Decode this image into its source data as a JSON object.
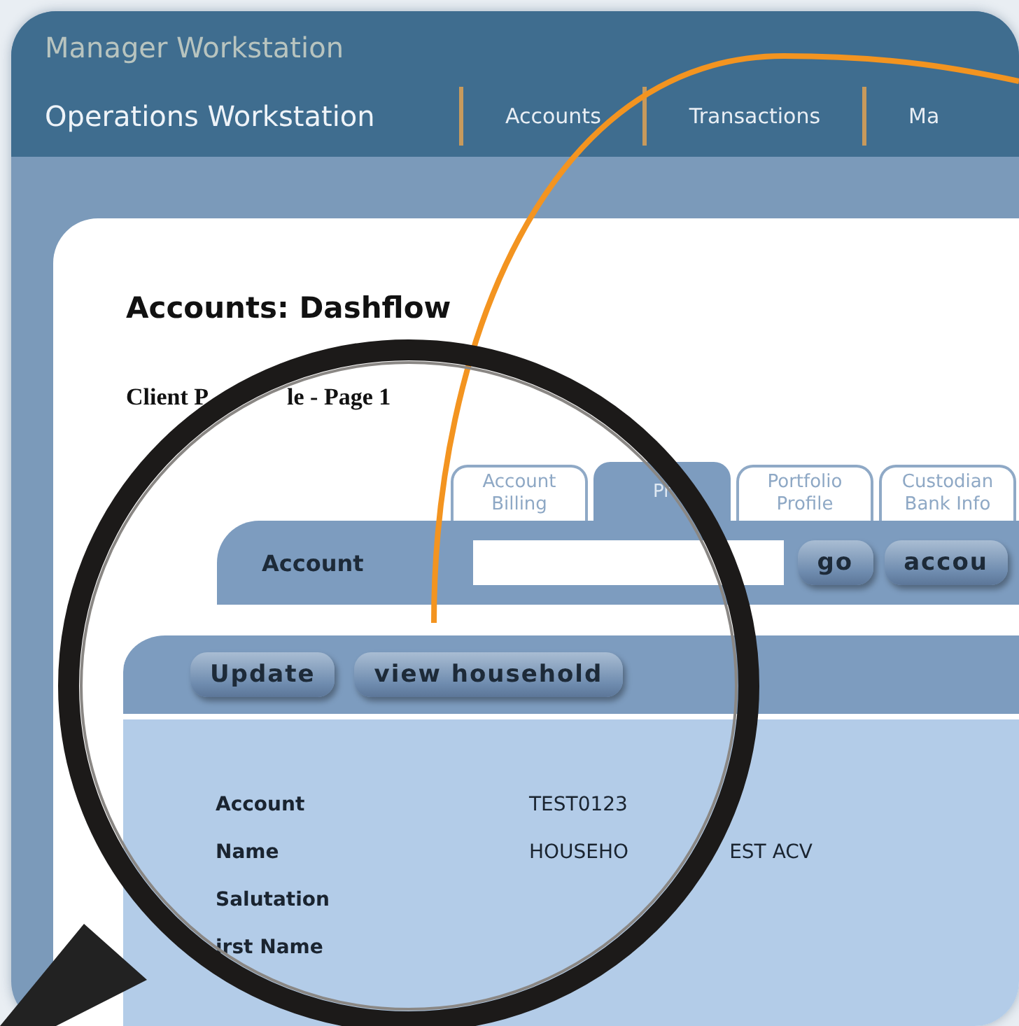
{
  "header": {
    "app_title": "Manager Workstation",
    "section_title": "Operations Workstation"
  },
  "nav": [
    {
      "label": "Accounts",
      "selected": false
    },
    {
      "label": "Transactions",
      "selected": false
    },
    {
      "label": "Ma",
      "selected": false
    }
  ],
  "page": {
    "title": "Accounts: Dashflow",
    "subtitle_parts": [
      "Client P",
      "le - Page 1"
    ]
  },
  "tabs": [
    {
      "label": "Account Billing",
      "selected": false
    },
    {
      "label": "Pr",
      "selected": true
    },
    {
      "label": "Portfolio Profile",
      "selected": false
    },
    {
      "label": "Custodian Bank Info",
      "selected": false
    }
  ],
  "account_bar": {
    "label": "Account",
    "buttons": [
      "go",
      "accou"
    ]
  },
  "actions": [
    "Update",
    "view household"
  ],
  "fields": [
    {
      "label": "Account",
      "value_parts": [
        "TEST0123"
      ]
    },
    {
      "label": "Name",
      "value_parts": [
        "HOUSEHO",
        "EST ACV"
      ]
    },
    {
      "label": "Salutation"
    },
    {
      "label": "irst Name"
    }
  ]
}
